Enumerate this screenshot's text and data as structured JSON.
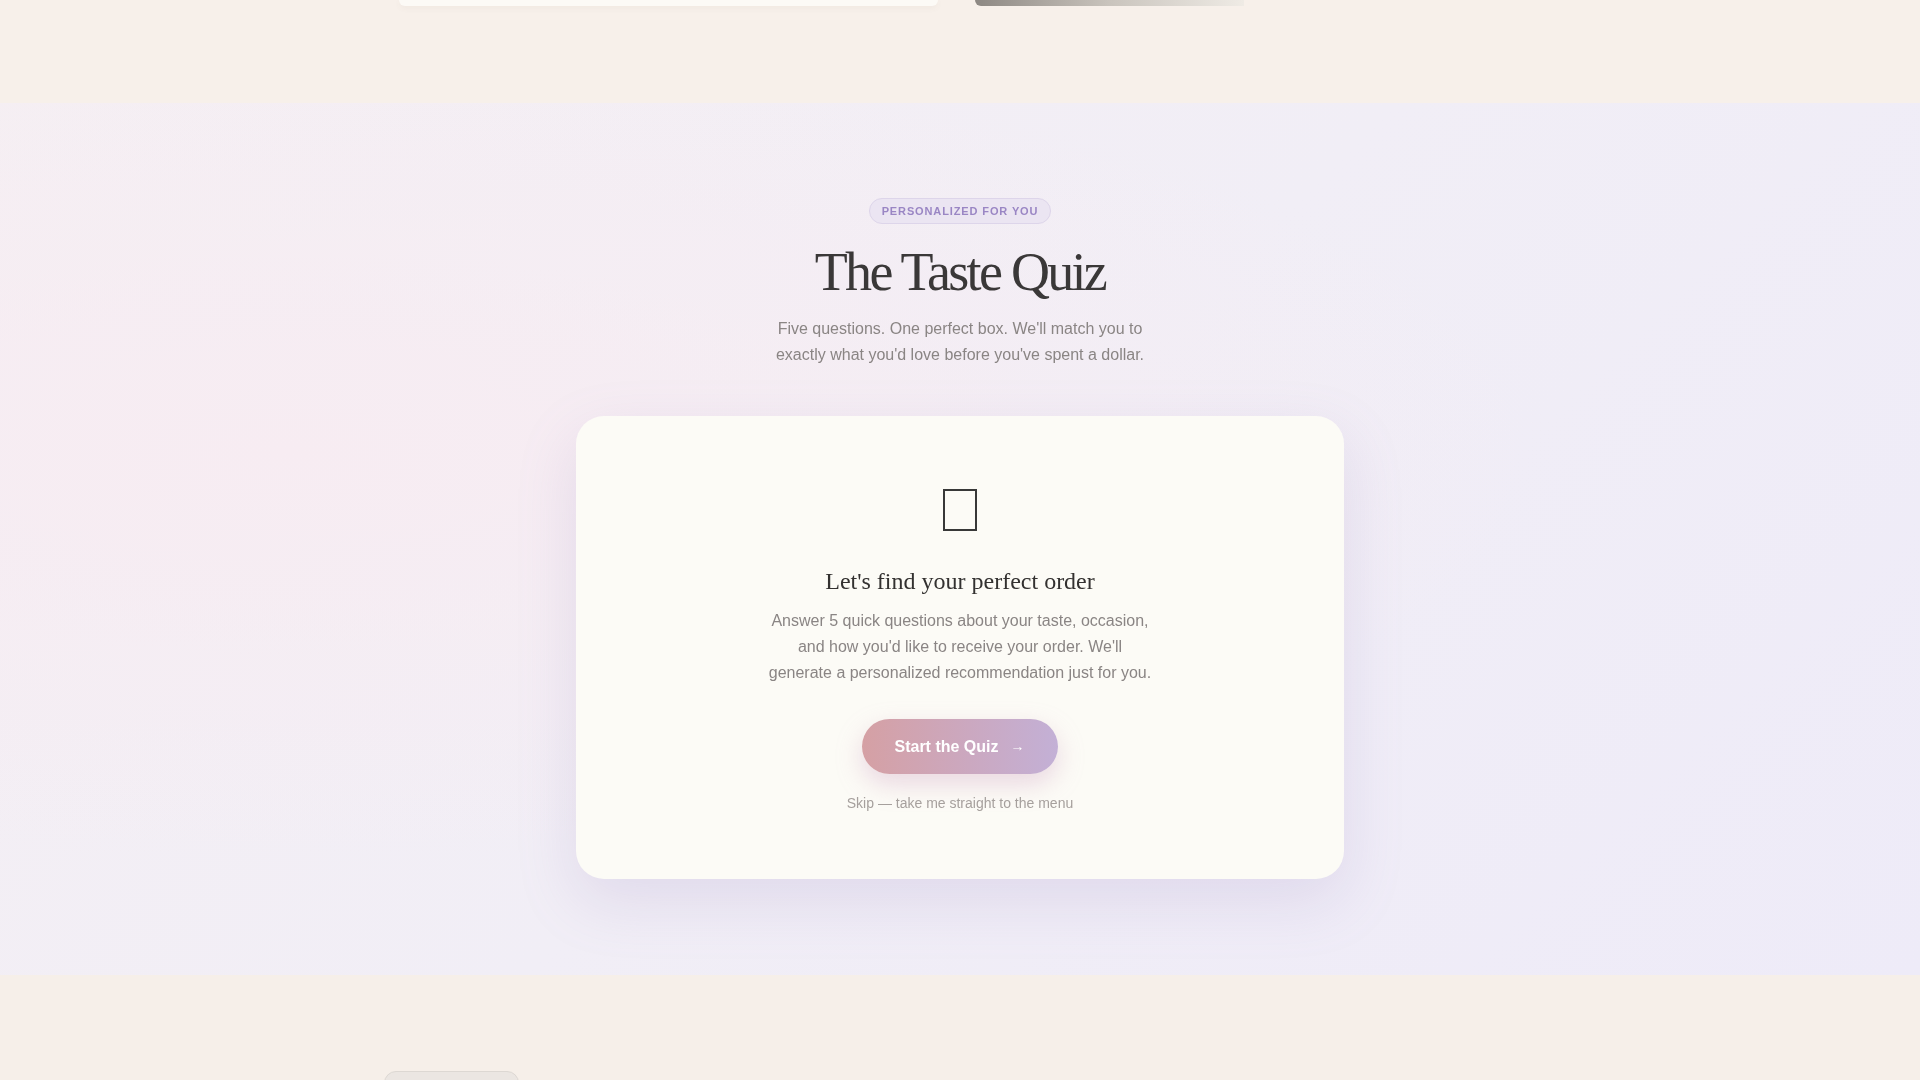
{
  "quiz_section": {
    "badge": "PERSONALIZED FOR YOU",
    "title": "The Taste Quiz",
    "subtitle": "Five questions. One perfect box. We'll match you to exactly what you'd love before you've spent a dollar.",
    "card": {
      "heading": "Let's find your perfect order",
      "text": "Answer 5 quick questions about your taste, occasion, and how you'd like to receive your order. We'll generate a personalized recommendation just for you.",
      "start_button": {
        "label": "Start the Quiz",
        "arrow": "→"
      },
      "skip_link": "Skip — take me straight to the menu"
    }
  }
}
